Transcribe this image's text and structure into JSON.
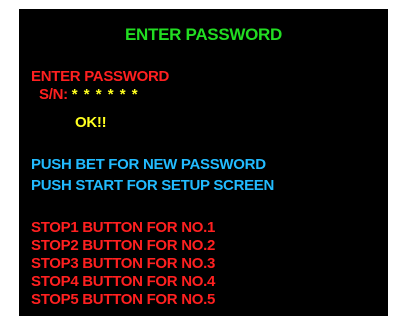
{
  "title": "ENTER PASSWORD",
  "prompt": "ENTER PASSWORD",
  "serial": {
    "label": "S/N:",
    "value": "* * * * * *"
  },
  "status": "OK!!",
  "instructions": [
    "PUSH BET FOR NEW PASSWORD",
    "PUSH START FOR SETUP SCREEN"
  ],
  "stop_buttons": [
    "STOP1 BUTTON FOR NO.1",
    "STOP2 BUTTON FOR NO.2",
    "STOP3 BUTTON FOR NO.3",
    "STOP4 BUTTON FOR NO.4",
    "STOP5 BUTTON FOR NO.5"
  ],
  "colors": {
    "background": "#000000",
    "title": "#22dd22",
    "prompt": "#ff2020",
    "value": "#ffff20",
    "instruction": "#22bbff"
  }
}
